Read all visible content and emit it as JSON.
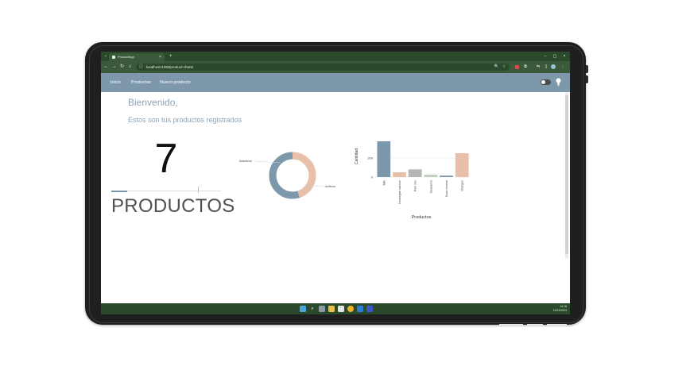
{
  "browser": {
    "tab_title": "ProductApp",
    "tab_close": "×",
    "new_tab": "+",
    "url": "localhost:4200/product-charts",
    "window_minimize": "–",
    "window_maximize": "▢",
    "window_close": "×"
  },
  "nav": {
    "links": [
      "Inicio",
      "Productos",
      "Nuevo producto"
    ]
  },
  "page": {
    "welcome": "Bienvenido,",
    "subtitle": "Estos son tus productos registrados",
    "product_count": "7",
    "products_label": "PRODUCTOS"
  },
  "taskbar": {
    "time": "14:16",
    "date": "11/01/2024"
  },
  "colors": {
    "navbar": "#7d98ab",
    "browser_dark": "#2b4a2c",
    "browser_toolbar": "#3b5a3c",
    "accent_peach": "#e8bfa8",
    "accent_blue": "#7d98ab",
    "gray": "#b5b5b5",
    "sage": "#c3cfc0"
  },
  "chart_data": [
    {
      "type": "pie",
      "labels": [
        "Inactivos",
        "Activos"
      ],
      "values": [
        45,
        55
      ],
      "colors": [
        "#e8bfa8",
        "#7d98ab"
      ]
    },
    {
      "type": "bar",
      "categories": [
        "Milk",
        "Norwegian salmon",
        "Pork ribs",
        "Gazpacho",
        "Ouzo cheese",
        "Oranges"
      ],
      "values": [
        375,
        50,
        80,
        25,
        15,
        250
      ],
      "colors": [
        "#7d98ab",
        "#e8bfa8",
        "#b5b5b5",
        "#c3cfc0",
        "#7d98ab",
        "#e8bfa8"
      ],
      "xlabel": "Productos",
      "ylabel": "Cantidad",
      "yticks": [
        0,
        200
      ],
      "ylim": [
        0,
        400
      ]
    }
  ]
}
